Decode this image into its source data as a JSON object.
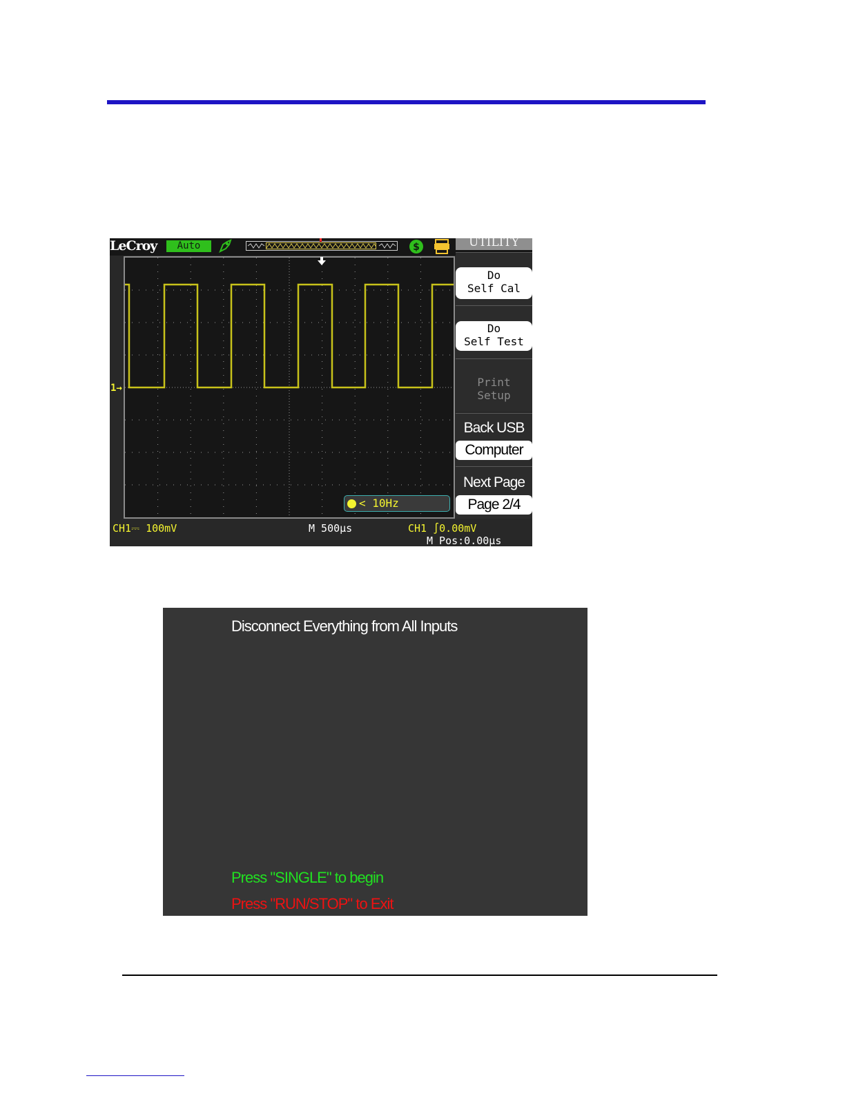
{
  "page": {
    "colors": {
      "header_rule": "#1d14c4",
      "footer_rule": "#000000"
    }
  },
  "scope": {
    "brand": "LeCroy",
    "acq_mode": "Auto",
    "icons": [
      "probe-icon",
      "dollar-icon",
      "printer-icon"
    ],
    "menu": {
      "title": "UTILITY",
      "items": [
        {
          "line1": "Do",
          "line2": "Self Cal"
        },
        {
          "line1": "Do",
          "line2": "Self Test"
        },
        {
          "line1": "Print",
          "line2": "Setup",
          "disabled": true
        },
        {
          "label": "Back USB",
          "value": "Computer"
        },
        {
          "label": "Next Page",
          "value": "Page 2/4"
        }
      ]
    },
    "channel_marker": "1→",
    "frequency": "< 10Hz",
    "status": {
      "ch1_scale": "CH1⎓ 100mV",
      "timebase": "M 500μs",
      "trigger": "CH1 ∫0.00mV",
      "m_pos": "M Pos:0.00μs"
    },
    "colors": {
      "trace": "#c8c21a",
      "label": "#f4f430",
      "mode_badge": "#2fbf1c"
    },
    "waveform": {
      "type": "square",
      "high_division": 1,
      "low_division": 4
    }
  },
  "cal_panel": {
    "title": "Disconnect Everything from All Inputs",
    "begin_prompt": "Press \"SINGLE\" to begin",
    "exit_prompt": "Press \"RUN/STOP\" to Exit",
    "colors": {
      "begin": "#21e021",
      "exit": "#ee1212"
    }
  }
}
